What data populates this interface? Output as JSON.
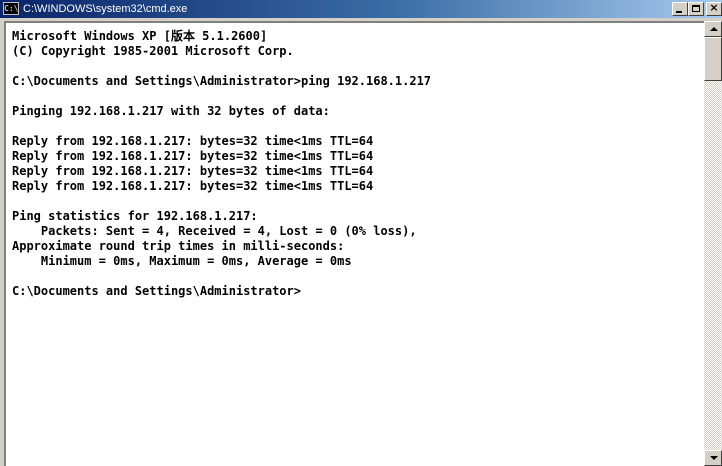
{
  "window": {
    "title": "C:\\WINDOWS\\system32\\cmd.exe",
    "icon_text": "C:\\",
    "icon_name": "console-icon",
    "close_glyph": "×"
  },
  "console": {
    "lines": [
      "Microsoft Windows XP [版本 5.1.2600]",
      "(C) Copyright 1985-2001 Microsoft Corp.",
      "",
      "C:\\Documents and Settings\\Administrator>ping 192.168.1.217",
      "",
      "Pinging 192.168.1.217 with 32 bytes of data:",
      "",
      "Reply from 192.168.1.217: bytes=32 time<1ms TTL=64",
      "Reply from 192.168.1.217: bytes=32 time<1ms TTL=64",
      "Reply from 192.168.1.217: bytes=32 time<1ms TTL=64",
      "Reply from 192.168.1.217: bytes=32 time<1ms TTL=64",
      "",
      "Ping statistics for 192.168.1.217:",
      "    Packets: Sent = 4, Received = 4, Lost = 0 (0% loss),",
      "Approximate round trip times in milli-seconds:",
      "    Minimum = 0ms, Maximum = 0ms, Average = 0ms",
      "",
      "C:\\Documents and Settings\\Administrator>"
    ]
  },
  "scrollbar": {
    "position": 0
  }
}
